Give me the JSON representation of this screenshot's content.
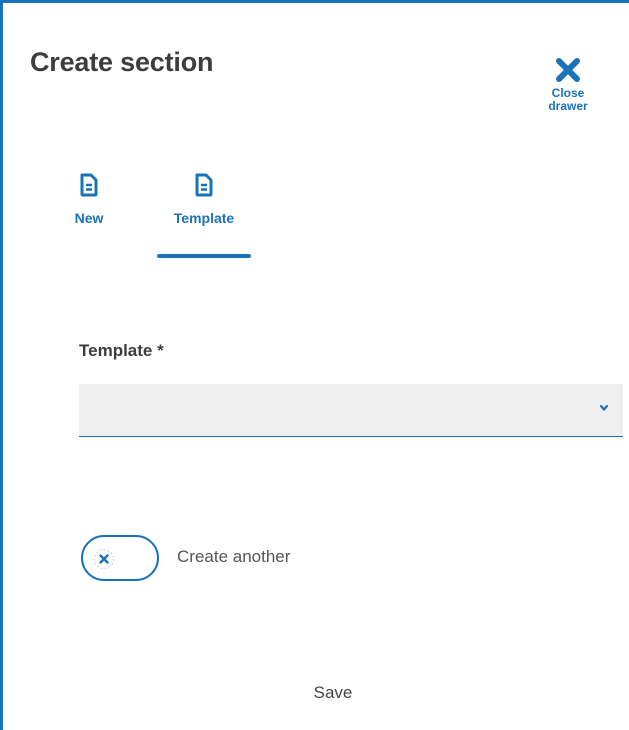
{
  "drawer": {
    "title": "Create section",
    "close_label": "Close\ndrawer"
  },
  "tabs": [
    {
      "label": "New",
      "icon": "document-icon",
      "selected": false
    },
    {
      "label": "Template",
      "icon": "document-icon",
      "selected": true
    }
  ],
  "form": {
    "template_label": "Template *",
    "template_value": "",
    "create_another_label": "Create another",
    "create_another_on": false
  },
  "footer": {
    "save_label": "Save"
  },
  "colors": {
    "accent": "#1a73b8",
    "text": "#3d3d3d",
    "field_bg": "#efefef"
  }
}
